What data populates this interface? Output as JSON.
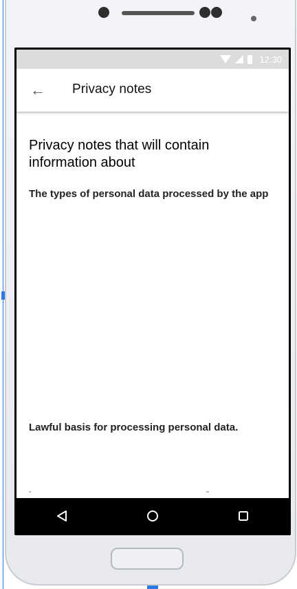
{
  "status_bar": {
    "time": "12:30",
    "icons": [
      "wifi-icon",
      "signal-icon",
      "battery-icon"
    ]
  },
  "app_bar": {
    "back_icon": "back-arrow-icon",
    "back_glyph": "←",
    "title": "Privacy notes"
  },
  "content": {
    "heading": "Privacy notes that will contain information about",
    "section1": "The types of personal data processed by the app",
    "section2": "Lawful basis for processing personal data."
  },
  "nav_bar": {
    "buttons": [
      "back-triangle-icon",
      "home-circle-icon",
      "recents-square-icon"
    ]
  },
  "colors": {
    "status_bar_bg": "#dcdcdc",
    "app_bar_bg": "#ffffff",
    "nav_bar_bg": "#000000",
    "phone_frame": "#eceef3"
  }
}
